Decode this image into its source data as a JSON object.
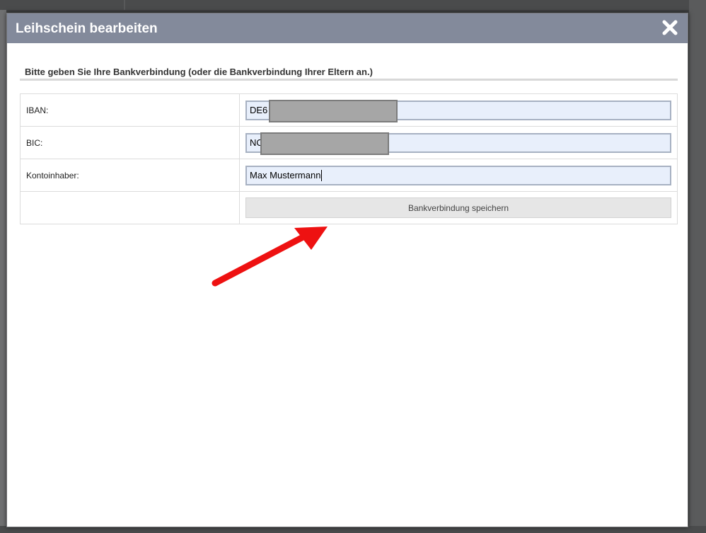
{
  "dialog": {
    "title": "Leihschein bearbeiten",
    "close_icon": "close-icon"
  },
  "form": {
    "heading": "Bitte geben Sie Ihre Bankverbindung (oder die Bankverbindung Ihrer Eltern an.)",
    "rows": [
      {
        "label": "IBAN:",
        "value": "DE6",
        "redacted": true
      },
      {
        "label": "BIC:",
        "value": "NO",
        "redacted": true
      },
      {
        "label": "Kontoinhaber:",
        "value": "Max Mustermann",
        "redacted": false
      }
    ],
    "save_label": "Bankverbindung speichern"
  },
  "annotation": {
    "arrow_color": "#ee1111"
  },
  "colors": {
    "titlebar": "#838a9b",
    "input_bg": "#e8effb",
    "input_border": "#a7b1c2"
  }
}
